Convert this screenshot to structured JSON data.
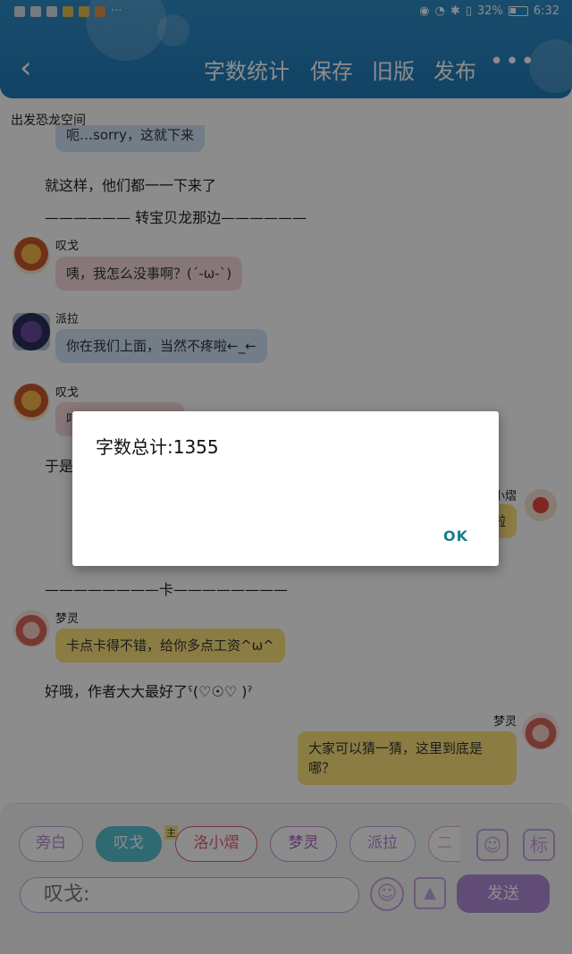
{
  "status_bar": {
    "battery": "32%",
    "time": "6:32"
  },
  "header": {
    "back": "‹",
    "actions": [
      "字数统计",
      "保存",
      "旧版",
      "发布"
    ],
    "more": "•••"
  },
  "space_title": "出发恐龙空间",
  "chat": {
    "m0_text": "呃…sorry，这就下来",
    "n1": "就这样，他们都一一下来了",
    "n2": "—————— 转宝贝龙那边——————",
    "m1_sender": "叹戈",
    "m1_text": "咦，我怎么没事啊？(´-ω-`)",
    "m2_sender": "派拉",
    "m2_text": "你在我们上面，当然不疼啦←_←",
    "m3_sender": "叹戈",
    "m3_text": "哼，那你可小心点",
    "n3": "于是",
    "m4_sender": "洛小熠",
    "m4_text": "好的，我知道啦",
    "n4": "————————卡————————",
    "m5_sender": "梦灵",
    "m5_text": "卡点卡得不错，给你多点工资^ω^",
    "n5": "好哦，作者大大最好了ˁ(♡☉♡ )ˀ",
    "m6_sender": "梦灵",
    "m6_text": "大家可以猜一猜，这里到底是哪？"
  },
  "dialog": {
    "message": "字数总计:1355",
    "ok": "OK"
  },
  "bottom": {
    "roles": [
      "旁白",
      "叹戈",
      "洛小熠",
      "梦灵",
      "派拉",
      "二"
    ],
    "zhu_badge": "主",
    "input_placeholder": "叹戈:",
    "send": "发送",
    "tag_icon_text": "标"
  },
  "colors": {
    "header": "#2f8cc6",
    "accent": "#b18ad8",
    "active_role": "#56bfd0",
    "ok": "#16808c"
  }
}
